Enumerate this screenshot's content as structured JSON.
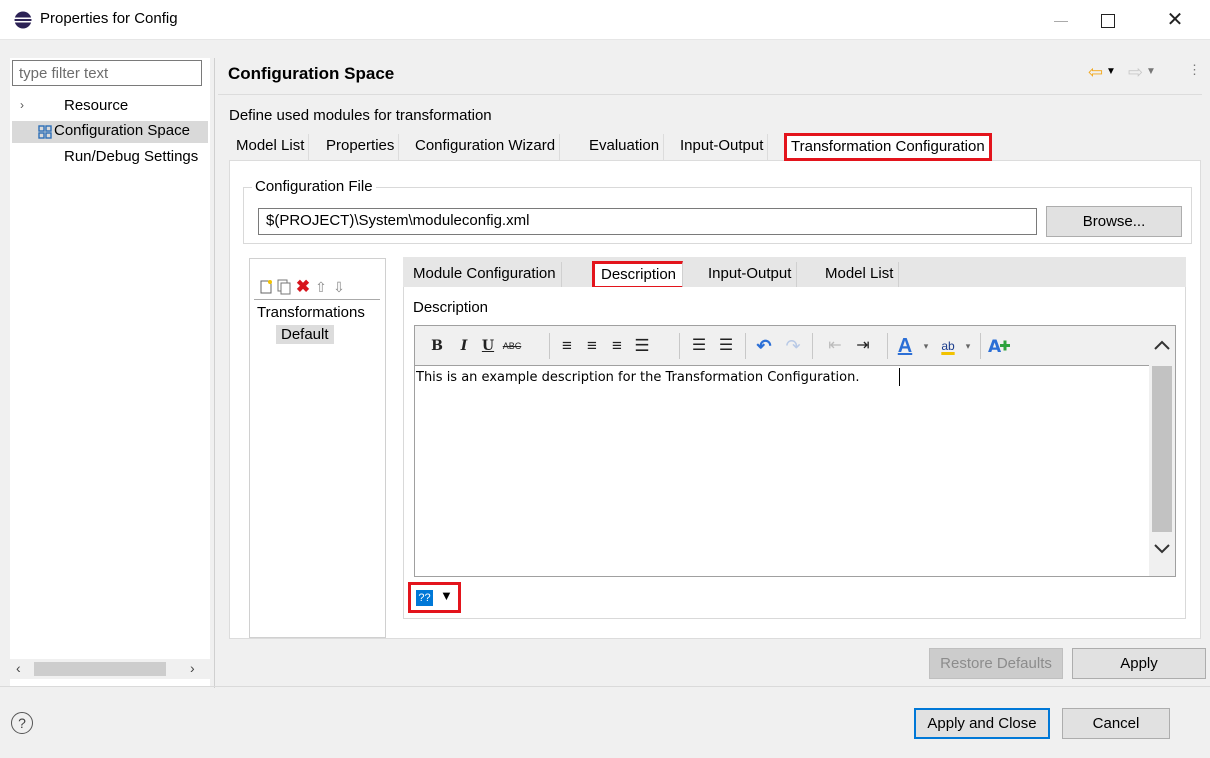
{
  "window": {
    "title": "Properties for Config",
    "close_glyph": "✕"
  },
  "sidebar": {
    "filter_placeholder": "type filter text",
    "items": [
      {
        "label": "Resource",
        "chevron": "›"
      },
      {
        "label": "Configuration Space"
      },
      {
        "label": "Run/Debug Settings"
      }
    ]
  },
  "page": {
    "title": "Configuration Space",
    "description": "Define used modules for transformation",
    "outer_tabs": [
      "Model List",
      "Properties",
      "Configuration Wizard",
      "Evaluation",
      "Input-Output",
      "Transformation Configuration"
    ],
    "config_file_group": "Configuration File",
    "config_file_value": "$(PROJECT)\\System\\moduleconfig.xml",
    "browse_label": "Browse...",
    "transformations_label": "Transformations",
    "transformations_items": [
      "Default"
    ],
    "inner_tabs": [
      "Module Configuration",
      "Description",
      "Input-Output",
      "Model List"
    ],
    "description_label": "Description",
    "editor_text": "This is an example description for the Transformation Configuration.",
    "language_value": "??",
    "toolbar": {
      "bold": "B",
      "italic": "I",
      "underline": "U",
      "strike": "ABC",
      "font_color": "A",
      "highlight": "ab"
    }
  },
  "buttons": {
    "restore_defaults": "Restore Defaults",
    "apply": "Apply",
    "apply_and_close": "Apply and Close",
    "cancel": "Cancel",
    "help": "?"
  },
  "colors": {
    "highlight_border": "#e3141c",
    "accent": "#0078d7"
  }
}
